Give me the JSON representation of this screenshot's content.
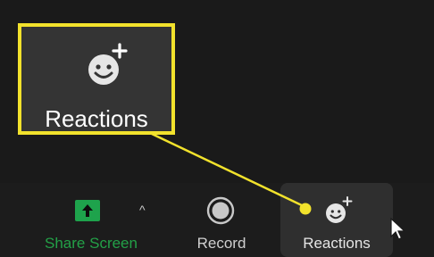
{
  "callout": {
    "label": "Reactions",
    "icon": "emoji-add-icon"
  },
  "toolbar": {
    "share_screen": {
      "label": "Share Screen",
      "icon": "share-arrow-up-icon",
      "caret": "^"
    },
    "record": {
      "label": "Record",
      "icon": "record-icon"
    },
    "reactions": {
      "label": "Reactions",
      "icon": "emoji-add-icon"
    }
  },
  "colors": {
    "highlight": "#f2e22c",
    "share_green": "#1ea34c",
    "background": "#1a1a1a"
  }
}
